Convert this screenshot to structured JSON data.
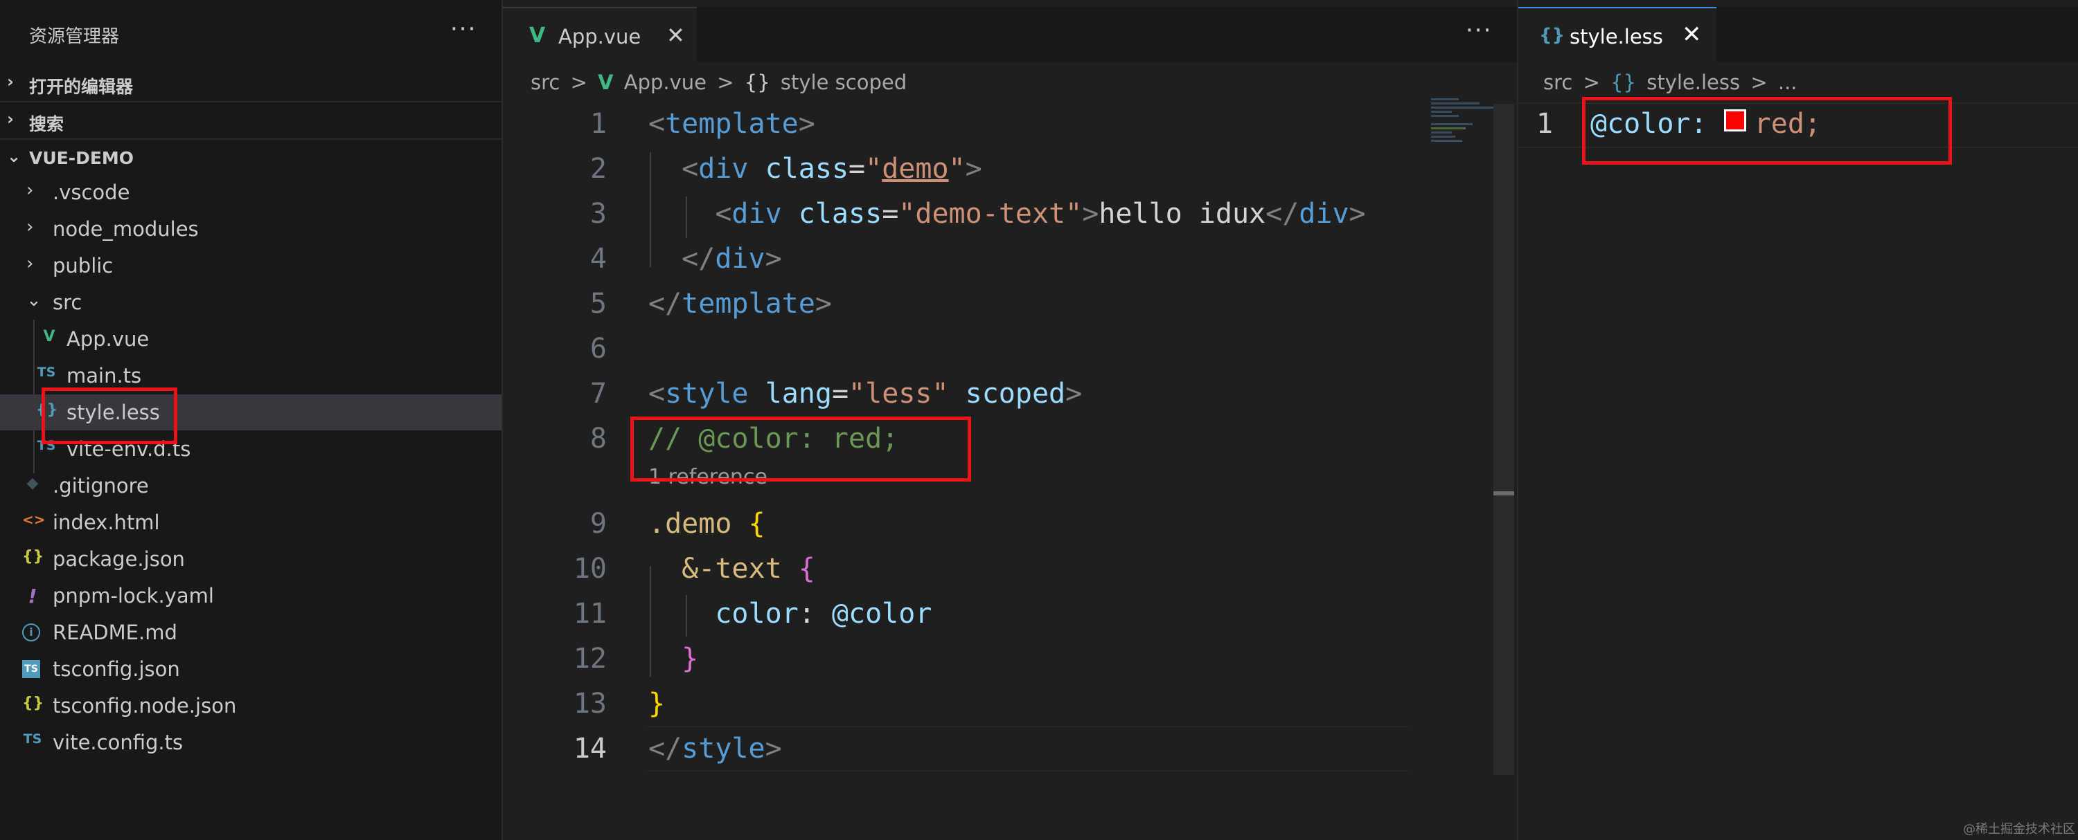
{
  "sidebar": {
    "title": "资源管理器",
    "more": "···",
    "sections": [
      "打开的编辑器",
      "搜索",
      "VUE-DEMO"
    ],
    "items": [
      {
        "name": ".vscode",
        "icon": "chevron-right"
      },
      {
        "name": "node_modules",
        "icon": "chevron-right"
      },
      {
        "name": "public",
        "icon": "chevron-right"
      },
      {
        "name": "src",
        "icon": "chevron-down"
      },
      {
        "name": "App.vue",
        "icon_text": "V"
      },
      {
        "name": "main.ts",
        "icon_text": "TS"
      },
      {
        "name": "style.less",
        "icon_text": "{}"
      },
      {
        "name": "vite-env.d.ts",
        "icon_text": "TS"
      },
      {
        "name": ".gitignore",
        "icon_text": "◆"
      },
      {
        "name": "index.html",
        "icon_text": "<>"
      },
      {
        "name": "package.json",
        "icon_text": "{}"
      },
      {
        "name": "pnpm-lock.yaml",
        "icon_text": "!"
      },
      {
        "name": "README.md",
        "icon_text": "i"
      },
      {
        "name": "tsconfig.json",
        "icon_text": "TS"
      },
      {
        "name": "tsconfig.node.json",
        "icon_text": "{}"
      },
      {
        "name": "vite.config.ts",
        "icon_text": "TS"
      }
    ]
  },
  "editor1": {
    "tab_label": "App.vue",
    "tab_close": "✕",
    "more": "···",
    "breadcrumb": [
      "src",
      ">",
      "App.vue",
      ">",
      "{}",
      "style scoped"
    ],
    "codelens": "1 reference",
    "line_numbers": [
      "1",
      "2",
      "3",
      "4",
      "5",
      "6",
      "7",
      "8",
      "9",
      "10",
      "11",
      "12",
      "13",
      "14"
    ]
  },
  "editor2": {
    "tab_label": "style.less",
    "tab_close": "✕",
    "breadcrumb": [
      "src",
      ">",
      "{}",
      "style.less",
      ">",
      "..."
    ],
    "line_number": "1",
    "code_var": "@color:",
    "code_value": "red;"
  },
  "colors": {
    "highlight": "#e8141a",
    "swatch": "#ff0000",
    "vue": "#41b883"
  },
  "watermark": "@稀土掘金技术社区"
}
